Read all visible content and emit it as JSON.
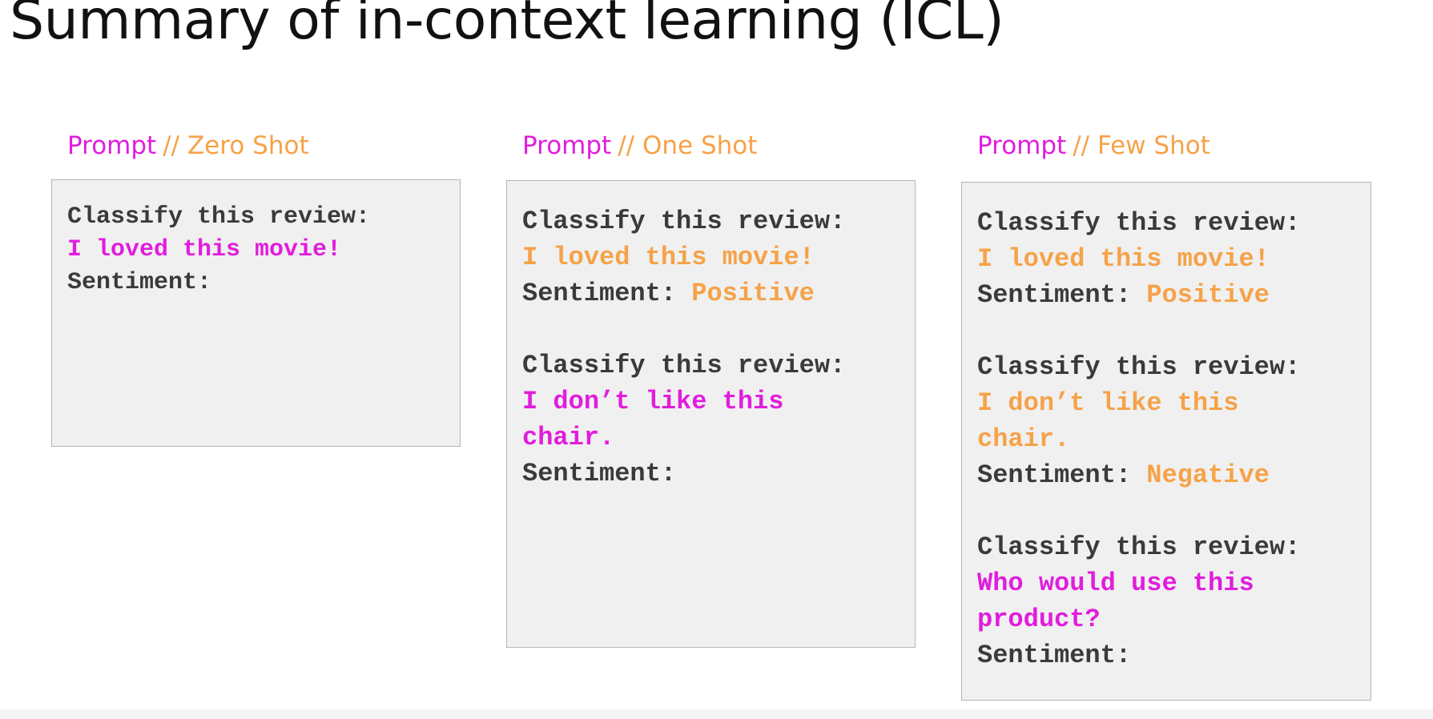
{
  "title": "Summary of in-context learning (ICL)",
  "colors": {
    "prompt_label": "#e11ddd",
    "example": "#f6a248",
    "input": "#e11ddd",
    "text": "#3a3a3a",
    "box_background": "#f0f0f0"
  },
  "panels": [
    {
      "label_prompt": "Prompt",
      "label_sep": "//",
      "label_type": "Zero Shot",
      "lines": {
        "l1": "Classify this review:",
        "l2": "I loved this movie!",
        "l3": "Sentiment:"
      }
    },
    {
      "label_prompt": "Prompt",
      "label_sep": "//",
      "label_type": "One Shot",
      "lines": {
        "l1": "Classify this review:",
        "l2": "I loved this movie!",
        "l3a": "Sentiment: ",
        "l3b": "Positive",
        "l4": "Classify this review:",
        "l5": "I don’t like this",
        "l6": "chair.",
        "l7": "Sentiment:"
      }
    },
    {
      "label_prompt": "Prompt",
      "label_sep": "//",
      "label_type": "Few Shot",
      "lines": {
        "l1": "Classify this review:",
        "l2": "I loved this movie!",
        "l3a": "Sentiment: ",
        "l3b": "Positive",
        "l4": "Classify this review:",
        "l5": "I don’t like this",
        "l6": "chair.",
        "l7a": "Sentiment: ",
        "l7b": "Negative",
        "l8": "Classify this review:",
        "l9": "Who would use this",
        "l10": "product?",
        "l11": "Sentiment:"
      }
    }
  ]
}
